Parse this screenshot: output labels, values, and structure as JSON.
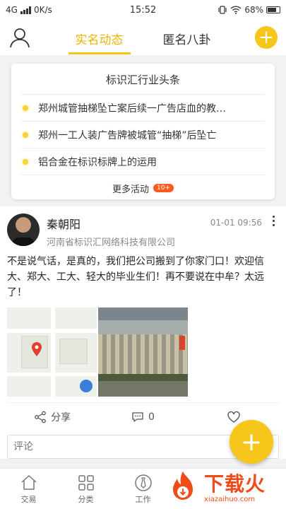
{
  "status_bar": {
    "network": "4G",
    "speed": "0K/s",
    "time": "15:52",
    "battery": "68%"
  },
  "top_nav": {
    "tabs": [
      {
        "label": "实名动态",
        "active": true
      },
      {
        "label": "匿名八卦",
        "active": false
      }
    ],
    "add_symbol": "+"
  },
  "headline_card": {
    "title": "标识汇行业头条",
    "items": [
      "郑州城管抽梯坠亡案后续一广告店血的教…",
      "郑州一工人装广告牌被城管“抽梯”后坠亡",
      "铝合金在标识标牌上的运用"
    ],
    "more_label": "更多活动",
    "more_badge": "10+"
  },
  "post": {
    "author": "秦朝阳",
    "org": "河南省标识汇网络科技有限公司",
    "time": "01-01 09:56",
    "text": "不是说气话，是真的，我们把公司搬到了你家门口！欢迎信大、郑大、工大、轻大的毕业生们！再不要说在中牟？太远了！",
    "share_label": "分享",
    "comment_count": "0",
    "comment_placeholder": "评论"
  },
  "fab_symbol": "+",
  "bottom_nav": [
    {
      "label": "交易",
      "icon": "house-icon"
    },
    {
      "label": "分类",
      "icon": "grid-icon"
    },
    {
      "label": "工作",
      "icon": "tie-icon"
    }
  ],
  "watermark": {
    "text": "下载火",
    "url": "xiazaihuo.com"
  },
  "colors": {
    "accent": "#f7c61a",
    "active_tab": "#f0b400",
    "badge": "#ff5a1f",
    "watermark": "#ef4c1a"
  }
}
